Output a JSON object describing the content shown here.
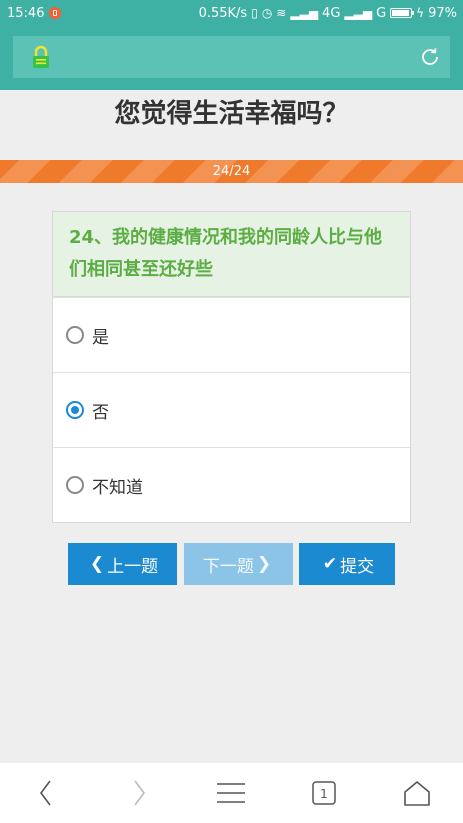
{
  "status_bar": {
    "time": "15:46",
    "network_speed": "0.55K/s",
    "signal_4g": "4G",
    "signal_g": "G",
    "battery": "97%"
  },
  "header": {
    "left_icon": "lock-icon",
    "right_icon": "refresh-icon"
  },
  "page": {
    "title": "您觉得生活幸福吗？"
  },
  "progress": {
    "label": "24/24",
    "current": 24,
    "total": 24
  },
  "question": {
    "text": "24、我的健康情况和我的同龄人比与他们相同甚至还好些",
    "options": [
      {
        "label": "是",
        "selected": false
      },
      {
        "label": "否",
        "selected": true
      },
      {
        "label": "不知道",
        "selected": false
      }
    ]
  },
  "buttons": {
    "prev": "上一题",
    "next": "下一题",
    "submit": "提交"
  },
  "bottom_nav": {
    "tab_count": "1"
  },
  "colors": {
    "header_bg": "#3fb0a4",
    "progress_bar": "#f07a2b",
    "question_text": "#5cad44",
    "primary_button": "#1b8ad0",
    "disabled_button": "#8bc4e6"
  }
}
